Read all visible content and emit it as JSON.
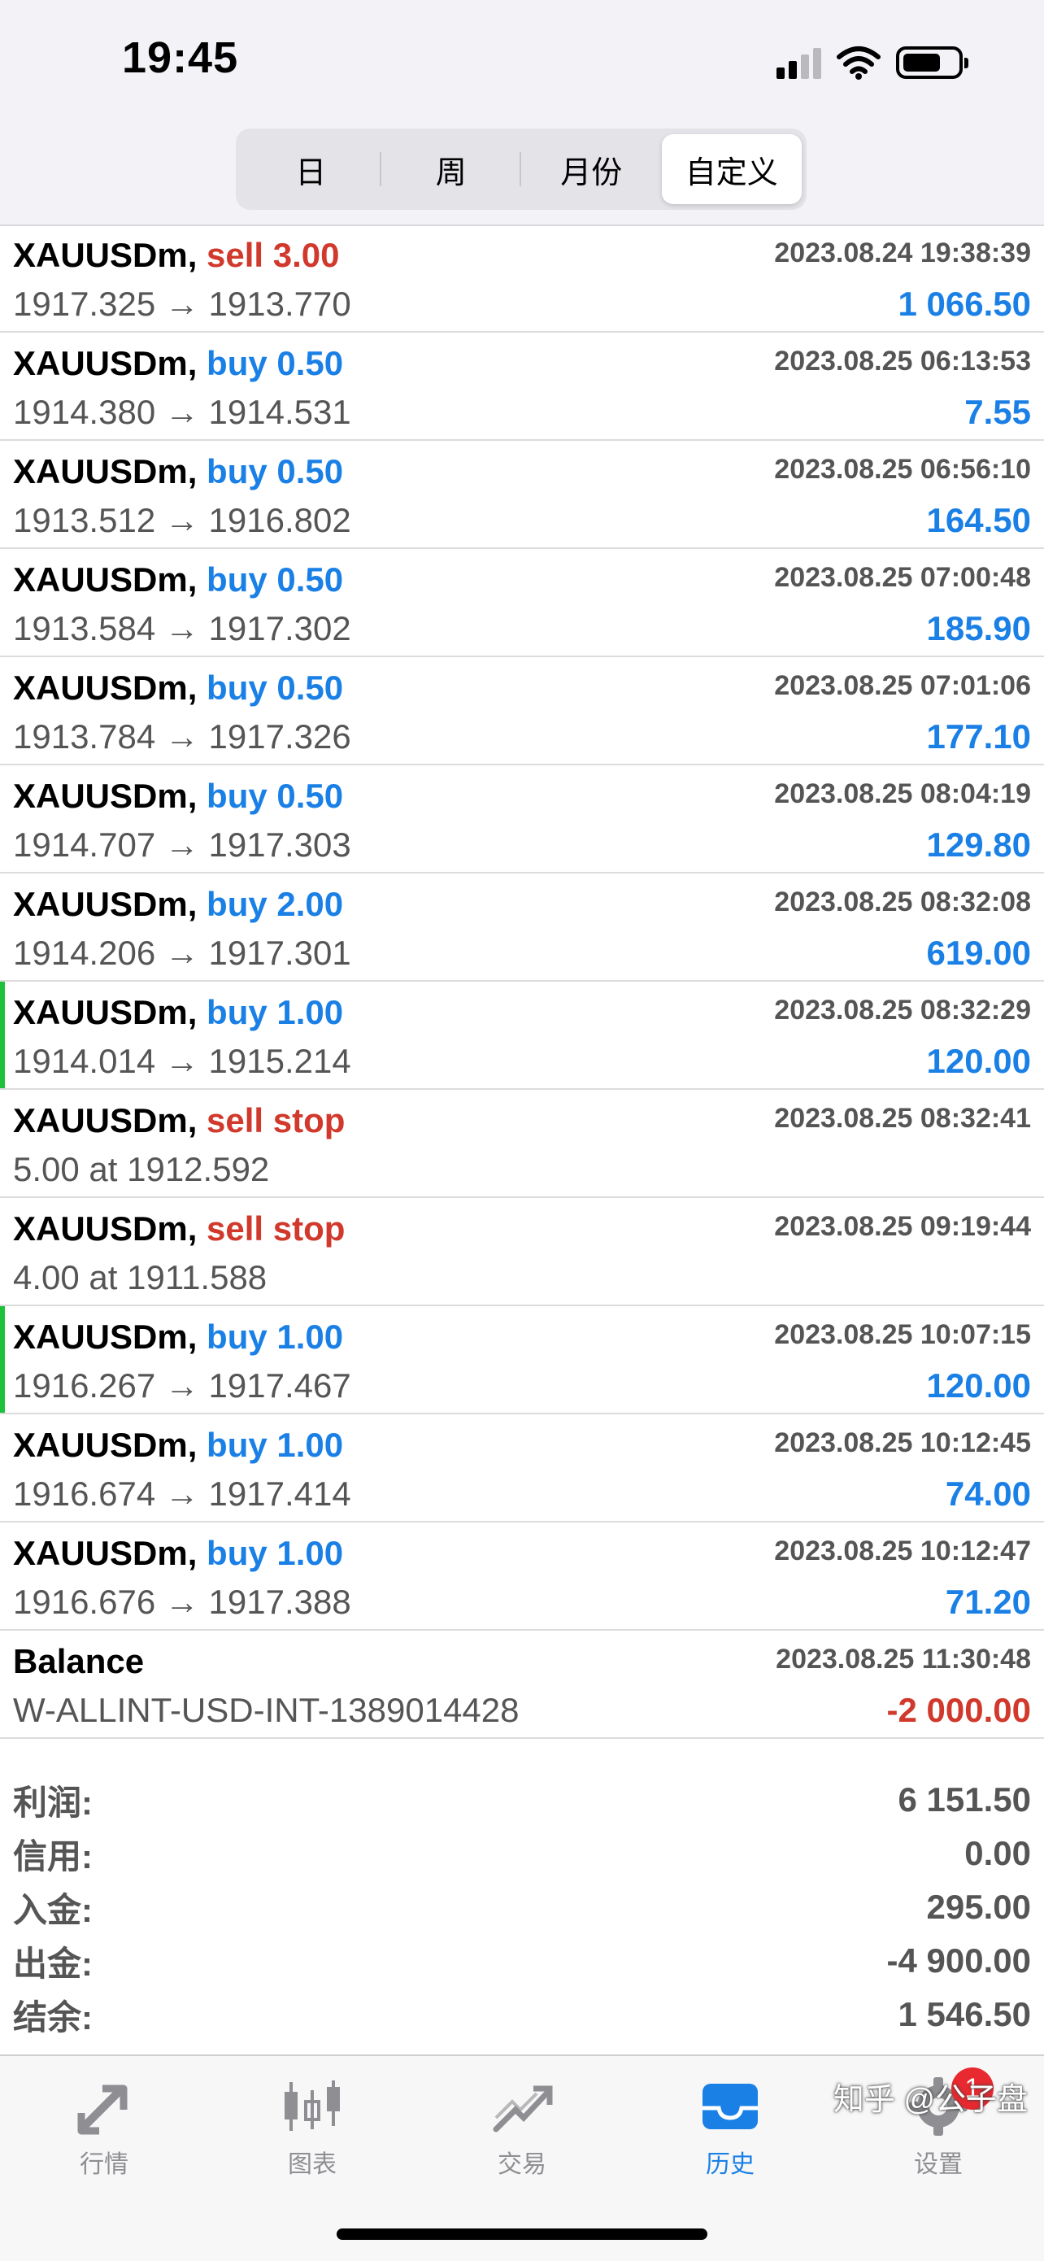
{
  "status_bar": {
    "time": "19:45"
  },
  "segments": [
    {
      "label": "日",
      "active": false
    },
    {
      "label": "周",
      "active": false
    },
    {
      "label": "月份",
      "active": false
    },
    {
      "label": "自定义",
      "active": true
    }
  ],
  "rows": [
    {
      "symbol": "XAUUSDm,",
      "action": "sell 3.00",
      "side": "sell",
      "date": "2023.08.24 19:38:39",
      "prices": "1917.325 → 1913.770",
      "profit": "1 066.50",
      "profit_sign": "pos",
      "marker": ""
    },
    {
      "symbol": "XAUUSDm,",
      "action": "buy 0.50",
      "side": "buy",
      "date": "2023.08.25 06:13:53",
      "prices": "1914.380 → 1914.531",
      "profit": "7.55",
      "profit_sign": "pos",
      "marker": ""
    },
    {
      "symbol": "XAUUSDm,",
      "action": "buy 0.50",
      "side": "buy",
      "date": "2023.08.25 06:56:10",
      "prices": "1913.512 → 1916.802",
      "profit": "164.50",
      "profit_sign": "pos",
      "marker": ""
    },
    {
      "symbol": "XAUUSDm,",
      "action": "buy 0.50",
      "side": "buy",
      "date": "2023.08.25 07:00:48",
      "prices": "1913.584 → 1917.302",
      "profit": "185.90",
      "profit_sign": "pos",
      "marker": ""
    },
    {
      "symbol": "XAUUSDm,",
      "action": "buy 0.50",
      "side": "buy",
      "date": "2023.08.25 07:01:06",
      "prices": "1913.784 → 1917.326",
      "profit": "177.10",
      "profit_sign": "pos",
      "marker": ""
    },
    {
      "symbol": "XAUUSDm,",
      "action": "buy 0.50",
      "side": "buy",
      "date": "2023.08.25 08:04:19",
      "prices": "1914.707 → 1917.303",
      "profit": "129.80",
      "profit_sign": "pos",
      "marker": ""
    },
    {
      "symbol": "XAUUSDm,",
      "action": "buy 2.00",
      "side": "buy",
      "date": "2023.08.25 08:32:08",
      "prices": "1914.206 → 1917.301",
      "profit": "619.00",
      "profit_sign": "pos",
      "marker": ""
    },
    {
      "symbol": "XAUUSDm,",
      "action": "buy 1.00",
      "side": "buy",
      "date": "2023.08.25 08:32:29",
      "prices": "1914.014 → 1915.214",
      "profit": "120.00",
      "profit_sign": "pos",
      "marker": "green"
    },
    {
      "symbol": "XAUUSDm,",
      "action": "sell stop",
      "side": "sell",
      "date": "2023.08.25 08:32:41",
      "prices": "5.00 at 1912.592",
      "profit": "",
      "profit_sign": "pos",
      "marker": ""
    },
    {
      "symbol": "XAUUSDm,",
      "action": "sell stop",
      "side": "sell",
      "date": "2023.08.25 09:19:44",
      "prices": "4.00 at 1911.588",
      "profit": "",
      "profit_sign": "pos",
      "marker": ""
    },
    {
      "symbol": "XAUUSDm,",
      "action": "buy 1.00",
      "side": "buy",
      "date": "2023.08.25 10:07:15",
      "prices": "1916.267 → 1917.467",
      "profit": "120.00",
      "profit_sign": "pos",
      "marker": "green"
    },
    {
      "symbol": "XAUUSDm,",
      "action": "buy 1.00",
      "side": "buy",
      "date": "2023.08.25 10:12:45",
      "prices": "1916.674 → 1917.414",
      "profit": "74.00",
      "profit_sign": "pos",
      "marker": ""
    },
    {
      "symbol": "XAUUSDm,",
      "action": "buy 1.00",
      "side": "buy",
      "date": "2023.08.25 10:12:47",
      "prices": "1916.676 → 1917.388",
      "profit": "71.20",
      "profit_sign": "pos",
      "marker": ""
    },
    {
      "symbol": "Balance",
      "action": "",
      "side": "",
      "date": "2023.08.25 11:30:48",
      "prices": "W-ALLINT-USD-INT-1389014428",
      "profit": "-2 000.00",
      "profit_sign": "neg",
      "marker": ""
    }
  ],
  "summary": [
    {
      "label": "利润:",
      "value": "6 151.50"
    },
    {
      "label": "信用:",
      "value": "0.00"
    },
    {
      "label": "入金:",
      "value": "295.00"
    },
    {
      "label": "出金:",
      "value": "-4 900.00"
    },
    {
      "label": "结余:",
      "value": "1 546.50"
    }
  ],
  "tabbar": [
    {
      "label": "行情",
      "icon": "quotes-icon",
      "active": false
    },
    {
      "label": "图表",
      "icon": "chart-icon",
      "active": false
    },
    {
      "label": "交易",
      "icon": "trade-icon",
      "active": false
    },
    {
      "label": "历史",
      "icon": "history-icon",
      "active": true
    },
    {
      "label": "设置",
      "icon": "settings-icon",
      "active": false,
      "badge": "1"
    }
  ],
  "watermark": "知乎 @公子盘",
  "colors": {
    "buy": "#1a80e6",
    "sell": "#d0392b",
    "accent": "#1a80e6",
    "marker_green": "#1ec13a"
  }
}
